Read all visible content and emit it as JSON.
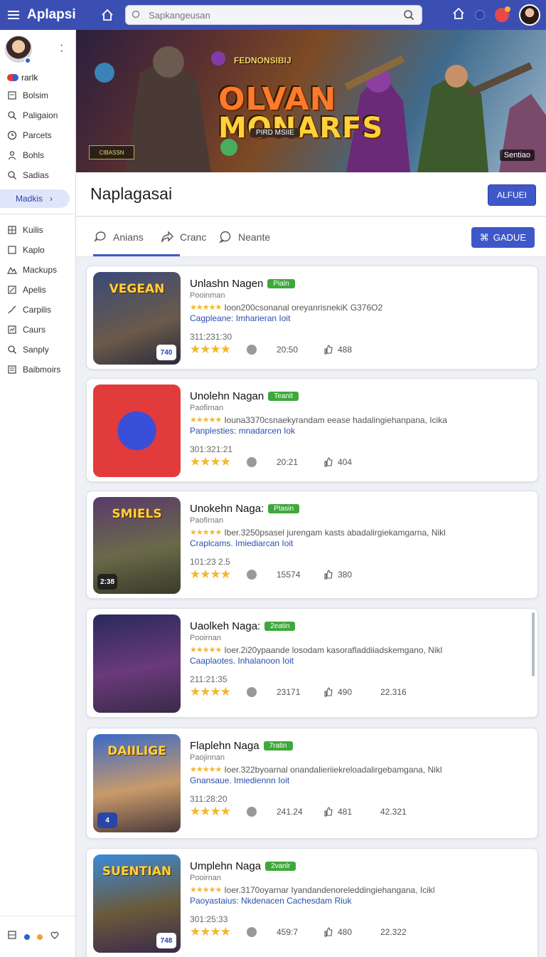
{
  "app": {
    "title": "Aplapsi"
  },
  "search": {
    "placeholder": "Sapkangeusan"
  },
  "sidebar": {
    "user": "rarlk",
    "items": [
      {
        "label": "Bolsim",
        "icon": "document-icon"
      },
      {
        "label": "Paligaion",
        "icon": "search-icon"
      },
      {
        "label": "Parcets",
        "icon": "clock-icon"
      },
      {
        "label": "Bohls",
        "icon": "person-icon"
      },
      {
        "label": "Sadias",
        "icon": "search-icon"
      }
    ],
    "active": "Madkis",
    "items2": [
      {
        "label": "Kuilis",
        "icon": "grid-icon"
      },
      {
        "label": "Kaplo",
        "icon": "square-icon"
      },
      {
        "label": "Mackups",
        "icon": "mountain-icon"
      },
      {
        "label": "Apelis",
        "icon": "edit-icon"
      },
      {
        "label": "Carpilis",
        "icon": "link-icon"
      },
      {
        "label": "Caurs",
        "icon": "chart-icon"
      },
      {
        "label": "Sanply",
        "icon": "search-icon"
      },
      {
        "label": "Baibmoirs",
        "icon": "book-icon"
      }
    ]
  },
  "banner": {
    "top": "FEDNONSIBIJ",
    "line1": "OLVAN",
    "line2": "MONARFS",
    "sub": "PIRD MSIIE",
    "logo": "CIBASSN",
    "tag": "Sentiao"
  },
  "page": {
    "title": "Naplagasai",
    "button": "ALFUEI"
  },
  "tabs": {
    "items": [
      "Anians",
      "Cranc",
      "Neante"
    ],
    "button": "GADUE"
  },
  "games": [
    {
      "name": "Unlashn Nagen",
      "tag": "Pialn",
      "publisher": "Pooinman",
      "desc": "Ioon200csonanal oreyanrisnekiK G376O2",
      "platform": "Cagpleane: Imharieran Ioit",
      "date": "311:231:30",
      "s1": "20:50",
      "s2": "488",
      "s3": "",
      "corner": "740",
      "thumb_label": "VEGEAN"
    },
    {
      "name": "Unolehn Nagan",
      "tag": "Teanit",
      "publisher": "Paofirnan",
      "desc": "Iouna3370csnaekyrandam eease hadalingiehanpana, Icika",
      "platform": "Panplesties: mnadarcen Iok",
      "date": "301:321:21",
      "s1": "20:21",
      "s2": "404",
      "s3": "",
      "corner": "",
      "thumb_label": ""
    },
    {
      "name": "Unokehn Naga:",
      "tag": "Ptasin",
      "publisher": "Paofirnan",
      "desc": "Iber.3250psasel jurengam kasts abadalirgiekamgarna, Nikl",
      "platform": "Craplcams. Imiediarcan Ioit",
      "date": "101:23 2.5",
      "s1": "15574",
      "s2": "380",
      "s3": "",
      "corner": "2:38",
      "thumb_label": "SMIELS"
    },
    {
      "name": "Uaolkeh Naga:",
      "tag": "2eatin",
      "publisher": "Pooirnan",
      "desc": "Ioer.2i20ypaande losodam kasorafladdiiadskemgano, Nikl",
      "platform": "Caaplaotes. Inhalanoon Ioit",
      "date": "211:21:35",
      "s1": "23171",
      "s2": "490",
      "s3": "22.316",
      "corner": "",
      "thumb_label": ""
    },
    {
      "name": "Flaplehn Naga",
      "tag": "7ratin",
      "publisher": "Paojinnan",
      "desc": "Ioer.322byoarnal onandalieriiekreloadalirgebamgana, Nikl",
      "platform": "Gnansaue. Imiediennn Ioit",
      "date": "311:28:20",
      "s1": "241.24",
      "s2": "481",
      "s3": "42.321",
      "corner": "4",
      "thumb_label": "DAIILIGE"
    },
    {
      "name": "Umplehn Naga",
      "tag": "2vanlr",
      "publisher": "Pooirnan",
      "desc": "Ioer.3170oyarnar Iyandandenoreleddingiehangana, Icikl",
      "platform": "Paoyastaius: Nkdenacen Cachesdam Riuk",
      "date": "301:25:33",
      "s1": "459:7",
      "s2": "480",
      "s3": "22.322",
      "corner": "748",
      "thumb_label": "SUENTIAN"
    }
  ],
  "colors": {
    "accent": "#3f58c8",
    "topbar": "#3b4fb3",
    "tag": "#3fa83a",
    "star": "#f5b72a"
  }
}
